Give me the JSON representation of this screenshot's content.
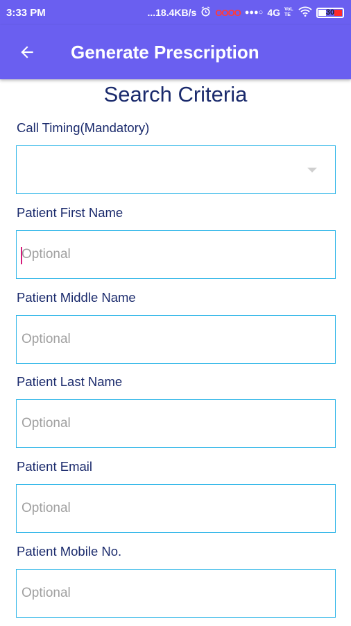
{
  "status_bar": {
    "time": "3:33 PM",
    "network_speed": "...18.4KB/s",
    "alarm_icon": "alarm-icon",
    "red_icons": "OOOO",
    "signal": "●●●○",
    "network_type": "4G",
    "volte": "VoLTE",
    "wifi_icon": "wifi-icon",
    "battery_level": "30"
  },
  "appbar": {
    "back_icon": "arrow-left-icon",
    "title": "Generate Prescription",
    "color": "#6a5ff0"
  },
  "section_title": "Search Criteria",
  "fields": {
    "call_timing": {
      "label": "Call Timing(Mandatory)",
      "value": ""
    },
    "first_name": {
      "label": "Patient First Name",
      "placeholder": "Optional"
    },
    "middle_name": {
      "label": "Patient Middle Name",
      "placeholder": "Optional"
    },
    "last_name": {
      "label": "Patient Last Name",
      "placeholder": "Optional"
    },
    "email": {
      "label": "Patient Email",
      "placeholder": "Optional"
    },
    "mobile": {
      "label": "Patient Mobile No.",
      "placeholder": "Optional"
    }
  },
  "colors": {
    "label_text": "#1a2a6c",
    "field_border": "#2fb6e8",
    "caret": "#d41a7a"
  }
}
